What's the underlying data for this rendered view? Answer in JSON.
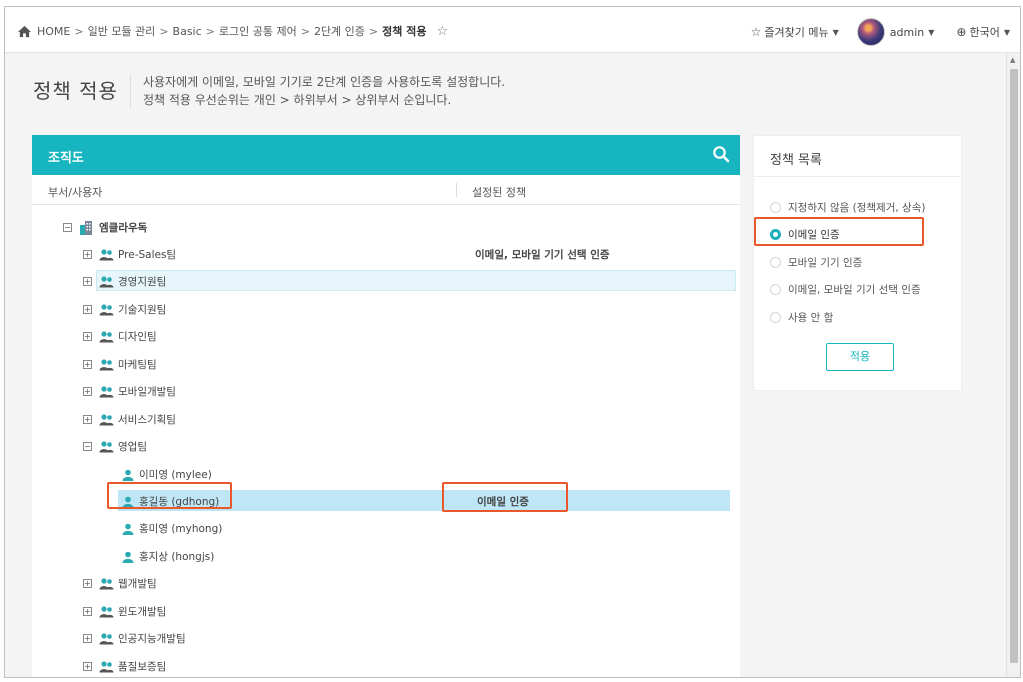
{
  "breadcrumb": {
    "items": [
      "HOME",
      "일반 모듈 관리",
      "Basic",
      "로그인 공통 제어",
      "2단계 인증"
    ],
    "current": "정책 적용",
    "separator": ">"
  },
  "header": {
    "favorites_label": "즐겨찾기 메뉴",
    "user_name": "admin",
    "language": "한국어"
  },
  "page": {
    "title": "정책 적용",
    "desc_line1": "사용자에게 이메일, 모바일 기기로 2단계 인증을 사용하도록 설정합니다.",
    "desc_line2": "정책 적용 우선순위는 개인 > 하위부서 > 상위부서 순입니다."
  },
  "org": {
    "title": "조직도",
    "col_dept_user": "부서/사용자",
    "col_policy": "설정된 정책",
    "root": "엠클라우독",
    "rows": [
      {
        "label": "Pre-Sales팀",
        "policy": "이메일, 모바일 기기 선택 인증"
      },
      {
        "label": "경영지원팀",
        "policy": ""
      },
      {
        "label": "기술지원팀",
        "policy": ""
      },
      {
        "label": "디자인팀",
        "policy": ""
      },
      {
        "label": "마케팅팀",
        "policy": ""
      },
      {
        "label": "모바일개발팀",
        "policy": ""
      },
      {
        "label": "서비스기획팀",
        "policy": ""
      },
      {
        "label": "영업팀",
        "policy": ""
      },
      {
        "label": "이미영 (mylee)",
        "policy": ""
      },
      {
        "label": "홍길동 (gdhong)",
        "policy": "이메일 인증"
      },
      {
        "label": "홍미영 (myhong)",
        "policy": ""
      },
      {
        "label": "홍지상 (hongjs)",
        "policy": ""
      },
      {
        "label": "웹개발팀",
        "policy": ""
      },
      {
        "label": "윈도개발팀",
        "policy": ""
      },
      {
        "label": "인공지능개발팀",
        "policy": ""
      },
      {
        "label": "품질보증팀",
        "policy": ""
      }
    ]
  },
  "policy_list": {
    "title": "정책 목록",
    "options": [
      "지정하지 않음 (정책제거, 상속)",
      "이메일 인증",
      "모바일 기기 인증",
      "이메일, 모바일 기기 선택 인증",
      "사용 안 함"
    ],
    "selected": "이메일 인증",
    "apply_label": "적용"
  },
  "colors": {
    "accent": "#16b5c0",
    "highlight_border": "#e8582b",
    "selected_row": "#bfe6f6"
  }
}
